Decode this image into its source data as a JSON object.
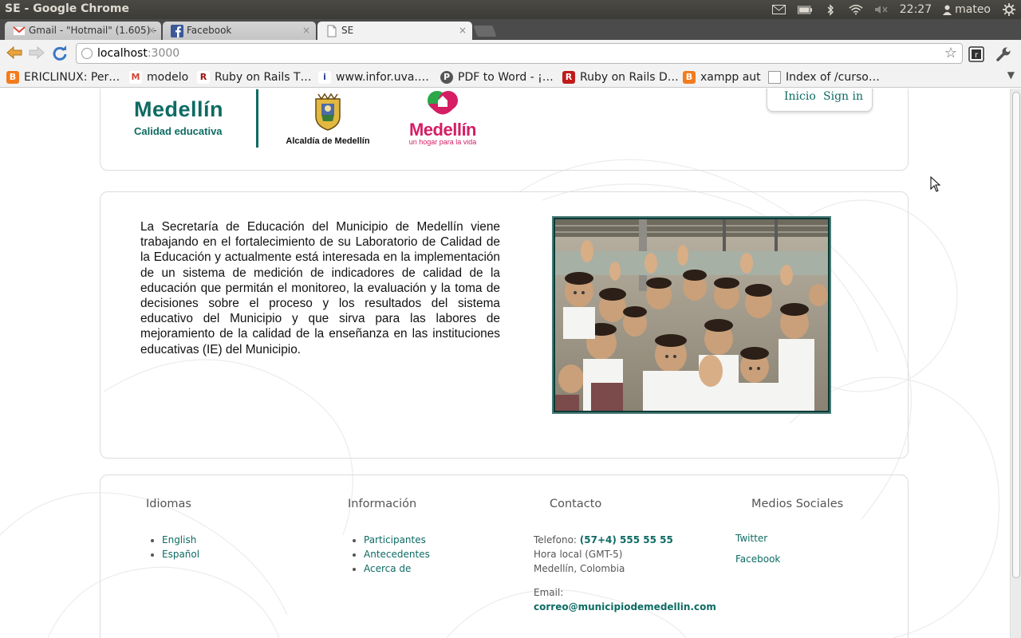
{
  "os": {
    "window_title": "SE - Google Chrome",
    "clock": "22:27",
    "user": "mateo"
  },
  "tabs": [
    {
      "label": "Gmail - \"Hotmail\" (1.605) -",
      "close": "×"
    },
    {
      "label": "Facebook",
      "close": "×"
    },
    {
      "label": "SE",
      "close": "×"
    }
  ],
  "address": {
    "host": "localhost",
    "port": ":3000"
  },
  "bookmarks": [
    {
      "label": "ERICLINUX: Per…",
      "icon": "B",
      "color": "#f37b1d"
    },
    {
      "label": "modelo",
      "icon": "M",
      "color": "#d44638"
    },
    {
      "label": "Ruby on Rails T…",
      "icon": "R",
      "color": "#9c0f0f"
    },
    {
      "label": "www.infor.uva.…",
      "icon": "i",
      "color": "#2a3f8f"
    },
    {
      "label": "PDF to Word - ¡…",
      "icon": "P",
      "color": "#555555"
    },
    {
      "label": "Ruby on Rails D…",
      "icon": "R",
      "color": "#c01a1a"
    },
    {
      "label": "xampp aut",
      "icon": "B",
      "color": "#f37b1d"
    },
    {
      "label": "Index of /curso…",
      "icon": "",
      "color": "#ffffff"
    }
  ],
  "colors": {
    "brand": "#0d6b63",
    "accent_pink": "#d51e64"
  },
  "header": {
    "logo_main": "Medellín",
    "logo_sub": "Calidad educativa",
    "alcaldia_label": "Alcaldía de Medellín",
    "medellin_word": "Medellín",
    "medellin_tagline": "un hogar para la vida",
    "nav": {
      "home": "Inicio",
      "signin": "Sign in"
    }
  },
  "main": {
    "intro": "La Secretaría de Educación del Municipio de Medellín viene trabajando en el fortalecimiento de su Laboratorio de Calidad de la Educación y actualmente está interesada en la implementación de un sistema de medición de indicadores de calidad de la educación que permitán el monitoreo, la evaluación y la toma de decisiones sobre el proceso y los resultados del sistema educativo del Municipio y que sirva para las labores de mejoramiento de la calidad de la enseñanza en las instituciones educativas (IE) del Municipio."
  },
  "footer": {
    "idiomas": {
      "title": "Idiomas",
      "items": [
        "English",
        "Español"
      ]
    },
    "informacion": {
      "title": "Información",
      "items": [
        "Participantes",
        "Antecedentes",
        "Acerca de"
      ]
    },
    "contacto": {
      "title": "Contacto",
      "phone_label": "Telefono:",
      "phone": "(57+4) 555 55 55",
      "hora": "Hora local (GMT-5)",
      "city": "Medellín, Colombia",
      "email_label": "Email:",
      "email": "correo@municipiodemedellin.com"
    },
    "social": {
      "title": "Medios Sociales",
      "twitter": "Twitter",
      "facebook": "Facebook"
    }
  }
}
